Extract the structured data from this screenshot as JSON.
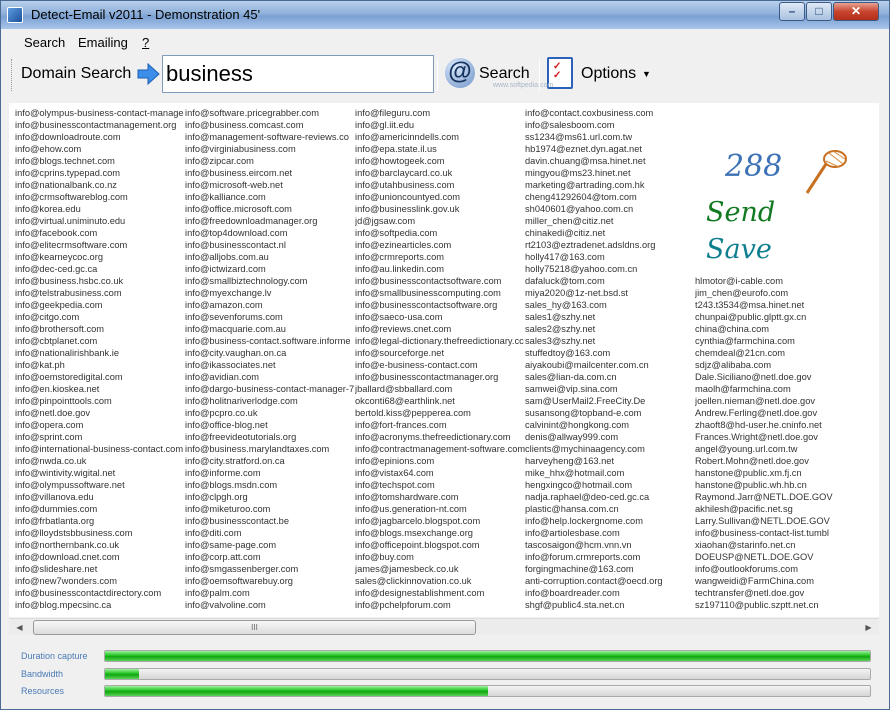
{
  "window": {
    "title": "Detect-Email v2011 - Demonstration 45'",
    "controls": {
      "minimize": "–",
      "maximize": "□",
      "close": "✕"
    }
  },
  "menu": {
    "items": [
      "Search",
      "Emailing",
      "?"
    ]
  },
  "toolbar": {
    "domain_search_label": "Domain Search",
    "search_value": "business",
    "search_button_label": "Search",
    "options_label": "Options",
    "watermark": "www.softpedia.com"
  },
  "icons": {
    "arrow": "right-arrow-icon",
    "at": "at-sign-icon",
    "options": "checklist-icon",
    "net": "butterfly-net-icon"
  },
  "colors": {
    "accent_blue": "#3c72b5",
    "send_green": "#137a22",
    "save_teal": "#0f7f90",
    "progress_green": "#22c322"
  },
  "results": {
    "count": "288",
    "send_label": "Send",
    "save_label": "Save",
    "columns": [
      [
        "info@olympus-business-contact-manage",
        "info@businesscontactmanagement.org",
        "info@downloadroute.com",
        "info@ehow.com",
        "info@blogs.technet.com",
        "info@cprins.typepad.com",
        "info@nationalbank.co.nz",
        "info@crmsoftwareblog.com",
        "info@korea.edu",
        "info@virtual.uniminuto.edu",
        "info@facebook.com",
        "info@elitecrmsoftware.com",
        "info@kearneycoc.org",
        "info@dec-ced.gc.ca",
        "info@business.hsbc.co.uk",
        "info@telstrabusiness.com",
        "info@geekpedia.com",
        "info@citgo.com",
        "info@brothersoft.com",
        "info@cbtplanet.com",
        "info@nationalirishbank.ie",
        "info@kat.ph",
        "info@oemstoredigital.com",
        "info@en.kioskea.net",
        "info@pinpointtools.com",
        "info@netl.doe.gov",
        "info@opera.com",
        "info@sprint.com",
        "info@international-business-contact.com",
        "info@nwda.co.uk",
        "info@wintivity.wigital.net",
        "info@olympussoftware.net",
        "info@villanova.edu",
        "info@dummies.com",
        "info@frbatlanta.org",
        "info@lloydstsbbusiness.com",
        "info@northernbank.co.uk",
        "info@download.cnet.com",
        "info@slideshare.net",
        "info@new7wonders.com",
        "info@businesscontactdirectory.com",
        "info@blog.mpecsinc.ca"
      ],
      [
        "info@software.pricegrabber.com",
        "info@business.comcast.com",
        "info@management-software-reviews.co",
        "info@virginiabusiness.com",
        "info@zipcar.com",
        "info@business.eircom.net",
        "info@microsoft-web.net",
        "info@kalliance.com",
        "info@office.microsoft.com",
        "info@freedownloadmanager.org",
        "info@top4download.com",
        "info@businesscontact.nl",
        "info@alljobs.com.au",
        "info@ictwizard.com",
        "info@smallbiztechnology.com",
        "info@myexchange.lv",
        "info@amazon.com",
        "info@sevenforums.com",
        "info@macquarie.com.au",
        "info@business-contact.software.informe",
        "info@city.vaughan.on.ca",
        "info@ikassociates.net",
        "info@avidian.com",
        "info@dargo-business-contact-manager-7",
        "info@holitnariverlodge.com",
        "info@pcpro.co.uk",
        "info@office-blog.net",
        "info@freevideotutorials.org",
        "info@business.marylandtaxes.com",
        "info@city.stratford.on.ca",
        "info@informe.com",
        "info@blogs.msdn.com",
        "info@clpgh.org",
        "info@miketuroo.com",
        "info@businesscontact.be",
        "info@diti.com",
        "info@same-page.com",
        "info@corp.att.com",
        "info@smgassenberger.com",
        "info@oemsoftwarebuy.org",
        "info@palm.com",
        "info@valvoline.com"
      ],
      [
        "info@fileguru.com",
        "info@gl.iit.edu",
        "info@americinndells.com",
        "info@epa.state.il.us",
        "info@howtogeek.com",
        "info@barclaycard.co.uk",
        "info@utahbusiness.com",
        "info@unioncountyed.com",
        "info@businesslink.gov.uk",
        "jd@jgsaw.com",
        "info@softpedia.com",
        "info@ezinearticles.com",
        "info@crmreports.com",
        "info@au.linkedin.com",
        "info@businesscontactsoftware.com",
        "info@smallbusinesscomputing.com",
        "info@businesscontactsoftware.org",
        "info@saeco-usa.com",
        "info@reviews.cnet.com",
        "info@legal-dictionary.thefreedictionary.cc",
        "info@sourceforge.net",
        "info@e-business-contact.com",
        "info@businesscontactmanager.org",
        "jballard@sbballard.com",
        "okconti68@earthlink.net",
        "bertold.kiss@pepperea.com",
        "info@fort-frances.com",
        "info@acronyms.thefreedictionary.com",
        "info@contractmanagement-software.com",
        "info@epinions.com",
        "info@vistax64.com",
        "info@techspot.com",
        "info@tomshardware.com",
        "info@us.generation-nt.com",
        "info@jagbarcelo.blogspot.com",
        "info@blogs.msexchange.org",
        "info@officepoint.blogspot.com",
        "info@buy.com",
        "james@jamesbeck.co.uk",
        "sales@clickinnovation.co.uk",
        "info@designestablishment.com",
        "info@pchelpforum.com"
      ],
      [
        "info@contact.coxbusiness.com",
        "info@salesboom.com",
        "ss1234@ms61.url.com.tw",
        "hb1974@eznet.dyn.agat.net",
        "davin.chuang@msa.hinet.net",
        "mingyou@ms23.hinet.net",
        "marketing@artrading.com.hk",
        "cheng41292604@tom.com",
        "sh040601@yahoo.com.cn",
        "miller_chen@citiz.net",
        "chinakedi@citiz.net",
        "rt2103@eztradenet.adsldns.org",
        "holly417@163.com",
        "holly75218@yahoo.com.cn",
        "dafaluck@tom.com",
        "miya2020@1z-net.bsd.st",
        "sales_hy@163.com",
        "sales1@szhy.net",
        "sales2@szhy.net",
        "sales3@szhy.net",
        "stuffedtoy@163.com",
        "aiyakoubi@mailcenter.com.cn",
        "sales@lian-da.com.cn",
        "samwei@vip.sina.com",
        "sam@UserMail2.FreeCity.De",
        "susansong@topband-e.com",
        "calvinint@hongkong.com",
        "denis@allway999.com",
        "clients@mychinaagency.com",
        "harveyheng@163.net",
        "mike_hhx@hotmail.com",
        "hengxingco@hotmail.com",
        "nadja.raphael@deo-ced.gc.ca",
        "plastic@hansa.com.cn",
        "info@help.lockergnome.com",
        "info@artiolesbase.com",
        "tascosaigon@hcm.vnn.vn",
        "info@forum.crmreports.com",
        "forgingmachine@163.com",
        "anti-corruption.contact@oecd.org",
        "info@boardreader.com",
        "shgf@public4.sta.net.cn"
      ],
      [
        "",
        "",
        "",
        "",
        "",
        "",
        "",
        "",
        "",
        "",
        "",
        "",
        "",
        "",
        "hlmotor@i-cable.com",
        "jim_chen@eurofo.com",
        "t243.t3534@msa.hinet.net",
        "chunpai@public.glptt.gx.cn",
        "china@china.com",
        "cynthia@farmchina.com",
        "chemdeal@21cn.com",
        "sdjz@alibaba.com",
        "Dale.Siciliano@netl.doe.gov",
        "maolh@farmchina.com",
        "joellen.nieman@netl.doe.gov",
        "Andrew.Ferling@netl.doe.gov",
        "zhaoft8@hd-user.he.cninfo.net",
        "Frances.Wright@netl.doe.gov",
        "angel@young.url.com.tw",
        "Robert.Mohn@netl.doe.gov",
        "hanstone@public.xm.fj.cn",
        "hanstone@public.wh.hb.cn",
        "Raymond.Jarr@NETL.DOE.GOV",
        "akhilesh@pacific.net.sg",
        "Larry.Sullivan@NETL.DOE.GOV",
        "info@business-contact-list.tumbl",
        "xiaohan@starinfo.net.cn",
        "DOEUSP@NETL.DOE.GOV",
        "info@outlookforums.com",
        "wangweidi@FarmChina.com",
        "techtransfer@netl.doe.gov",
        "sz197110@public.szptt.net.cn"
      ]
    ]
  },
  "scrollbar": {
    "grip": "III",
    "left_arrow": "◀",
    "right_arrow": "▶"
  },
  "progress": [
    {
      "label": "Duration capture",
      "value": 1.0
    },
    {
      "label": "Bandwidth",
      "value": 0.045
    },
    {
      "label": "Resources",
      "value": 0.5
    }
  ]
}
